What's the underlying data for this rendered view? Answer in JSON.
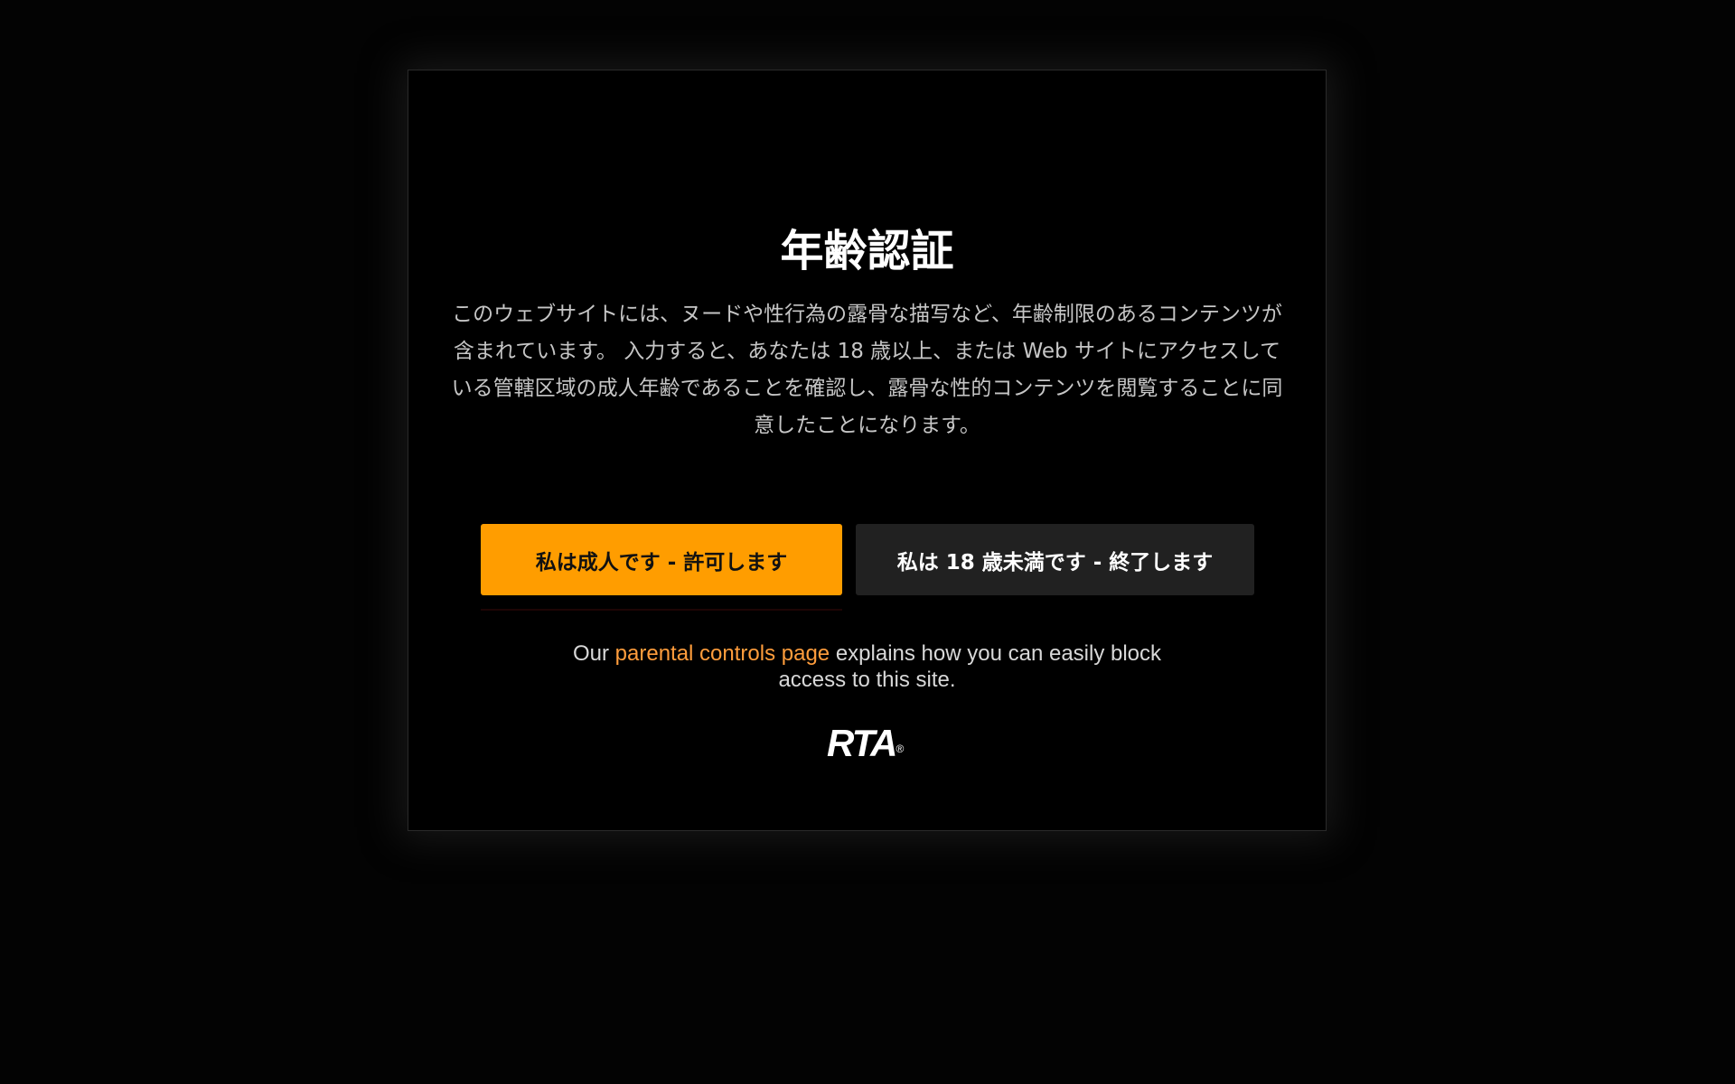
{
  "modal": {
    "title": "年齢認証",
    "description": "このウェブサイトには、ヌードや性行為の露骨な描写など、年齢制限のあるコンテンツが含まれています。 入力すると、あなたは 18 歳以上、または Web サイトにアクセスしている管轄区域の成人年齢であることを確認し、露骨な性的コンテンツを閲覧することに同意したことになります。",
    "enter_button": "私は成人です - 許可します",
    "exit_button": "私は 18 歳未満です - 終了します",
    "parental": {
      "prefix": "Our ",
      "link": "parental controls page",
      "suffix": " explains how you can easily block access to this site."
    },
    "logo_text": "RTA",
    "logo_mark": "®"
  },
  "colors": {
    "accent": "#ff9d00",
    "link": "#ff9d3c",
    "exit_button_bg": "#212121",
    "background": "#030303"
  }
}
